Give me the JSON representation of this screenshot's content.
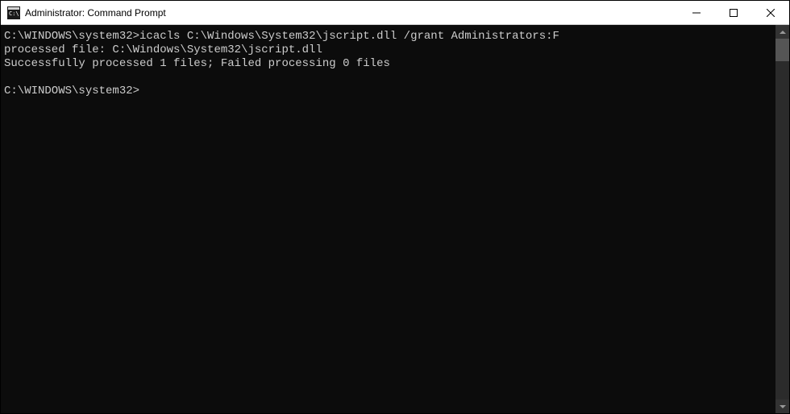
{
  "window": {
    "title": "Administrator: Command Prompt"
  },
  "terminal": {
    "line1_prompt": "C:\\WINDOWS\\system32>",
    "line1_command": "icacls C:\\Windows\\System32\\jscript.dll /grant Administrators:F",
    "line2": "processed file: C:\\Windows\\System32\\jscript.dll",
    "line3": "Successfully processed 1 files; Failed processing 0 files",
    "blank": "",
    "line4_prompt": "C:\\WINDOWS\\system32>"
  }
}
